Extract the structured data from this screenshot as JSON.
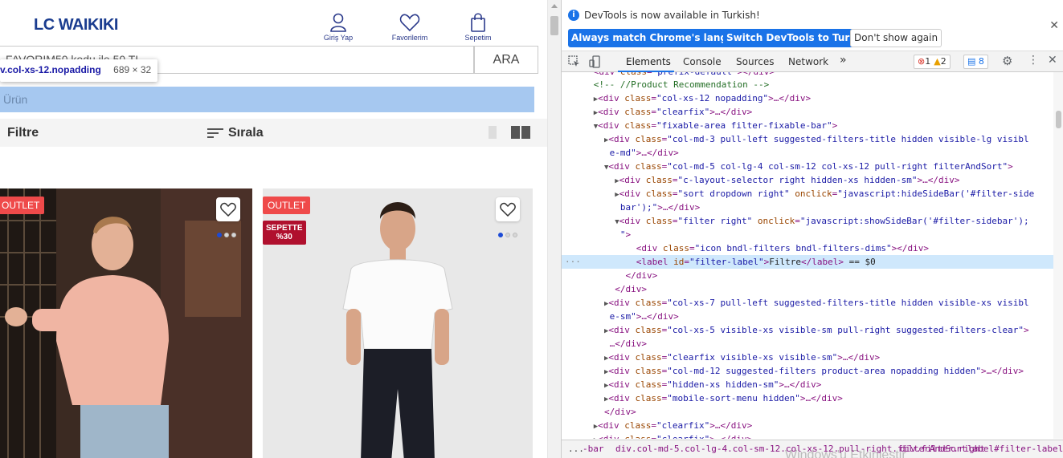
{
  "site": {
    "brand": "LC WAIKIKI",
    "header_actions": [
      {
        "label": "Giriş Yap",
        "icon": "user-icon"
      },
      {
        "label": "Favorilerim",
        "icon": "heart-icon"
      },
      {
        "label": "Sepetim",
        "icon": "bag-icon"
      }
    ],
    "search_value": "FAVORIM50 kodu ile 50 TL",
    "search_button": "ARA",
    "inspect_tooltip": {
      "selector": "v.col-xs-12.nopadding",
      "size": "689 × 32"
    },
    "highlight_text": "Ürün",
    "filter_label": "Filtre",
    "sort_label": "Sırala",
    "products": [
      {
        "badge": "OUTLET"
      },
      {
        "badge": "OUTLET",
        "promo_line1": "SEPETTE",
        "promo_line2": "%30"
      }
    ]
  },
  "devtools": {
    "info_message": "DevTools is now available in Turkish!",
    "info_buttons": [
      "Always match Chrome's language",
      "Switch DevTools to Turkish",
      "Don't show again"
    ],
    "tabs": [
      "Elements",
      "Console",
      "Sources",
      "Network"
    ],
    "more_tabs": "»",
    "errors": "1",
    "warnings": "2",
    "messages": "8",
    "selected_suffix": " == $0",
    "breadcrumbs": [
      "...",
      "-bar",
      "div.col-md-5.col-lg-4.col-sm-12.col-xs-12.pull-right.filterAndSort",
      "div.filter.right",
      "label#filter-label"
    ],
    "watermark": "Windows'u Etkinleştir"
  },
  "colors": {
    "brand": "#1a3c8f",
    "highlight": "#a6c8f0",
    "badge": "#ef4a4a",
    "promo": "#b0102e",
    "devtools_accent": "#1a73e8"
  }
}
